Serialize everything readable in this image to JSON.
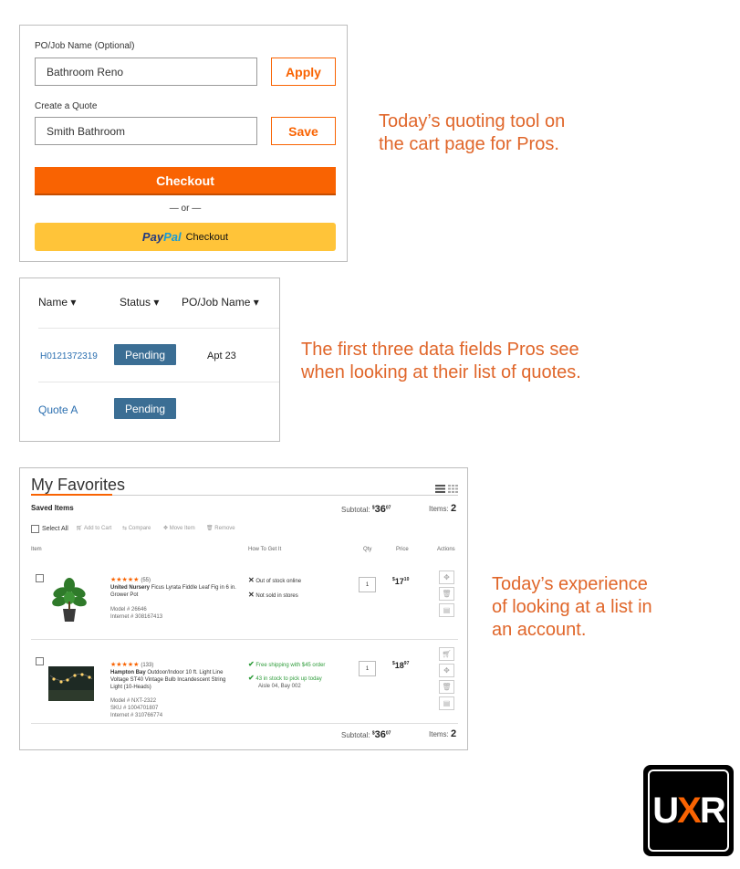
{
  "panel1": {
    "po_label": "PO/Job Name (Optional)",
    "po_value": "Bathroom Reno",
    "apply_label": "Apply",
    "quote_label": "Create a Quote",
    "quote_value": "Smith Bathroom",
    "save_label": "Save",
    "checkout_label": "Checkout",
    "or_text": "— or —",
    "paypal_part1": "Pay",
    "paypal_part2": "Pal",
    "paypal_label": "Checkout"
  },
  "captions": {
    "c1": [
      "Today’s quoting tool on",
      "the cart page for Pros."
    ],
    "c2": [
      "The first three data fields Pros see",
      "when looking at their list of quotes."
    ],
    "c3": [
      "Today’s experience",
      "of looking at a list in",
      "an account."
    ]
  },
  "quotes": {
    "headers": [
      "Name ▾",
      "Status ▾",
      "PO/Job Name ▾"
    ],
    "rows": [
      {
        "name": "H0121372319",
        "status": "Pending",
        "po": "Apt 23"
      },
      {
        "name": "Quote A",
        "status": "Pending",
        "po": ""
      }
    ]
  },
  "favorites": {
    "title": "My Favorites",
    "saved_items": "Saved Items",
    "subtotal_label": "Subtotal:",
    "subtotal_dollar": "$",
    "subtotal_whole": "36",
    "subtotal_cents": "07",
    "items_label": "Items:",
    "items_count": "2",
    "toolbar": {
      "select_all": "Select All",
      "add_to_cart": "Add to Cart",
      "compare": "Compare",
      "move_item": "Move Item",
      "remove": "Remove"
    },
    "columns": {
      "item": "Item",
      "how": "How To Get It",
      "qty": "Qty",
      "price": "Price",
      "actions": "Actions"
    },
    "products": [
      {
        "stars": "★★★★★",
        "reviews": "(55)",
        "brand": "United Nursery",
        "name_l1": "Ficus Lyrata Fiddle Leaf Fig in 6 in.",
        "name_l2": "Grower Pot",
        "model": "Model # 26646",
        "sku": "",
        "internet": "Internet # 308167413",
        "avail1": "Out of stock online",
        "avail2": "Not sold in stores",
        "avail2b": "",
        "qty": "1",
        "price_dollar": "$",
        "price_whole": "17",
        "price_cents": "10"
      },
      {
        "stars": "★★★★★",
        "reviews": "(133)",
        "brand": "Hampton Bay",
        "name_l1": "Outdoor/Indoor 10 ft. Light Line",
        "name_l2": "Voltage ST40 Vintage Bulb Incandescent String",
        "name_l3": "Light (10-Heads)",
        "model": "Model # NXT-2322",
        "sku": "SKU # 1004701807",
        "internet": "Internet # 310766774",
        "avail1": "Free shipping with $45 order",
        "avail2": "43 in stock to pick up today",
        "avail2b": "Aisle 04, Bay 002",
        "qty": "1",
        "price_dollar": "$",
        "price_whole": "18",
        "price_cents": "97"
      }
    ]
  },
  "logo": {
    "part1": "U",
    "part2": "X",
    "part3": "R"
  },
  "colors": {
    "accent": "#f96302",
    "caption": "#e0662a",
    "badge": "#3b6e94",
    "paypal": "#ffc439",
    "link": "#2b6fb0"
  }
}
